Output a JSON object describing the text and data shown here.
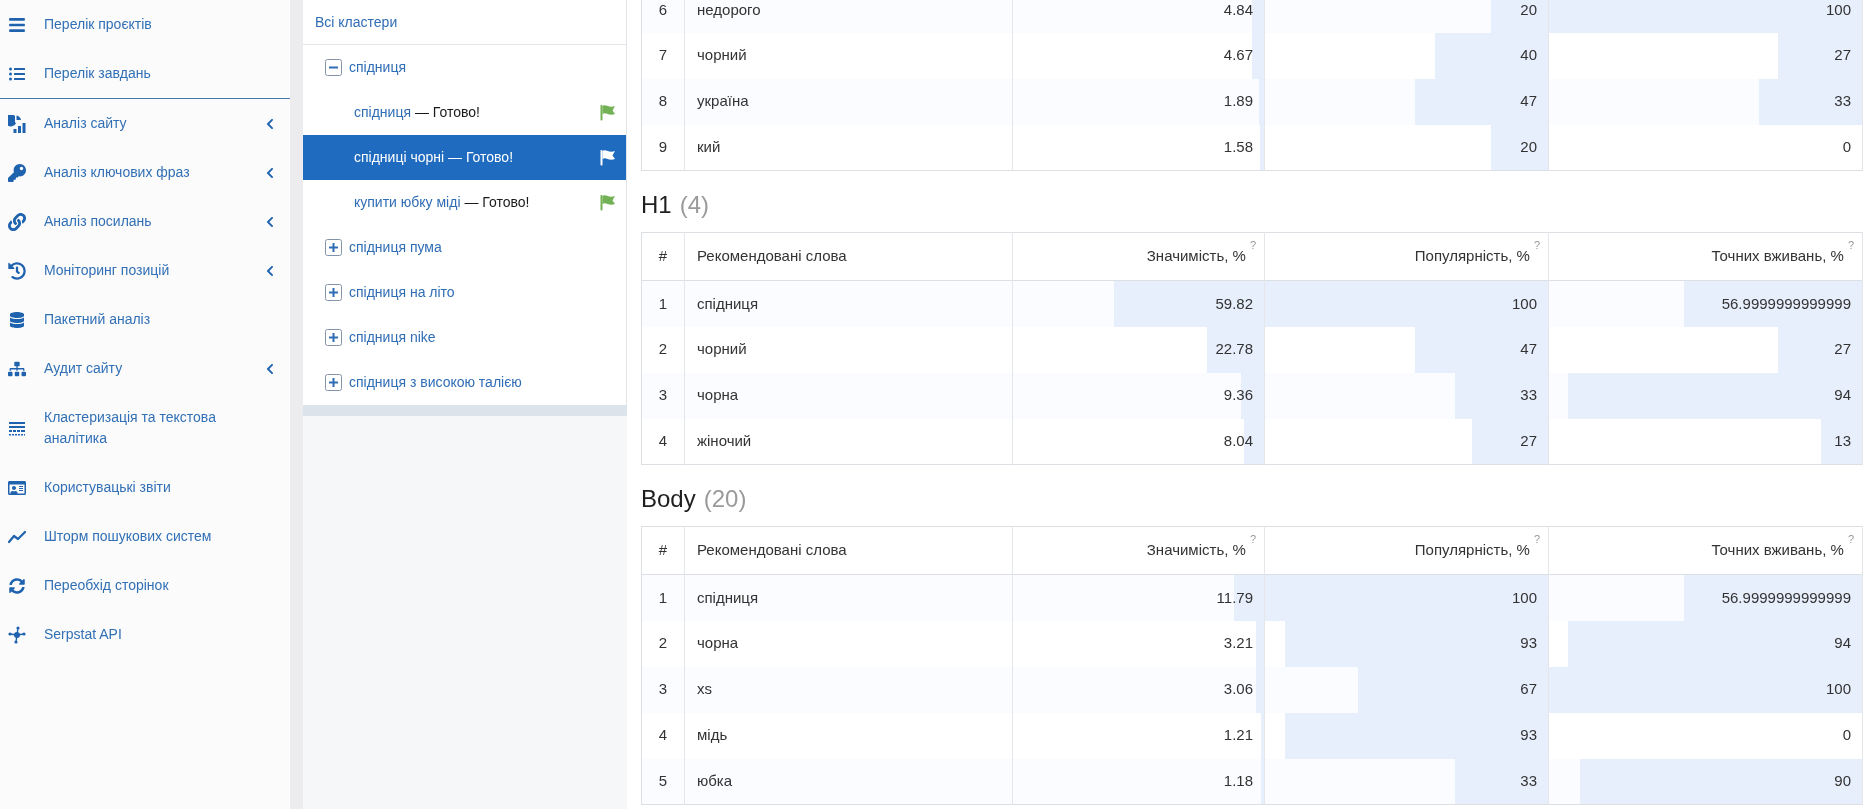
{
  "sidebar": {
    "top_items": [
      {
        "label": "Перелік проєктів",
        "has_submenu": false
      },
      {
        "label": "Перелік завдань",
        "has_submenu": false
      }
    ],
    "items": [
      {
        "label": "Аналіз сайту",
        "has_submenu": true
      },
      {
        "label": "Аналіз ключових фраз",
        "has_submenu": true
      },
      {
        "label": "Аналіз посилань",
        "has_submenu": true
      },
      {
        "label": "Моніторинг позицій",
        "has_submenu": true
      },
      {
        "label": "Пакетний аналіз",
        "has_submenu": false
      },
      {
        "label": "Аудит сайту",
        "has_submenu": true
      },
      {
        "label": "Кластеризація та текстова аналітика",
        "has_submenu": false
      },
      {
        "label": "Користувацькі звіти",
        "has_submenu": false
      },
      {
        "label": "Шторм пошукових систем",
        "has_submenu": false
      },
      {
        "label": "Переобхід сторінок",
        "has_submenu": false
      },
      {
        "label": "Serpstat API",
        "has_submenu": false
      }
    ]
  },
  "tree": {
    "header": "Всі кластери",
    "nodes": [
      {
        "label": "спідниця",
        "expanded": true,
        "children": [
          {
            "label": "спідниця",
            "status": "— Готово!",
            "selected": false
          },
          {
            "label": "спідниці чорні",
            "status": "— Готово!",
            "selected": true
          },
          {
            "label": "купити юбку міді",
            "status": "— Готово!",
            "selected": false
          }
        ]
      },
      {
        "label": "спідниця пума",
        "expanded": false
      },
      {
        "label": "спідниця на літо",
        "expanded": false
      },
      {
        "label": "спідниця nike",
        "expanded": false
      },
      {
        "label": "спідниця з високою талією",
        "expanded": false
      }
    ]
  },
  "sections": [
    {
      "rows": [
        {
          "number": "6",
          "word": "недорого",
          "metrics": [
            {
              "value": "4.84",
              "level": 0.0484
            },
            {
              "value": "20",
              "level": 0.2
            },
            {
              "value": "100",
              "level": 1
            }
          ]
        },
        {
          "number": "7",
          "word": "чорний",
          "metrics": [
            {
              "value": "4.67",
              "level": 0.0467
            },
            {
              "value": "40",
              "level": 0.4
            },
            {
              "value": "27",
              "level": 0.27
            }
          ]
        },
        {
          "number": "8",
          "word": "україна",
          "metrics": [
            {
              "value": "1.89",
              "level": 0.0189
            },
            {
              "value": "47",
              "level": 0.47
            },
            {
              "value": "33",
              "level": 0.33
            }
          ]
        },
        {
          "number": "9",
          "word": "кий",
          "metrics": [
            {
              "value": "1.58",
              "level": 0.0158
            },
            {
              "value": "20",
              "level": 0.2
            },
            {
              "value": "0",
              "level": 0
            }
          ]
        }
      ]
    },
    {
      "title": "H1",
      "count": "(4)",
      "columns": [
        {
          "label": "#"
        },
        {
          "label": "Рекомендовані слова"
        },
        {
          "label": "Значимість, %",
          "hint": "?"
        },
        {
          "label": "Популярність, %",
          "hint": "?"
        },
        {
          "label": "Точних вживань, %",
          "hint": "?"
        }
      ],
      "rows": [
        {
          "number": "1",
          "word": "спідниця",
          "metrics": [
            {
              "value": "59.82",
              "level": 0.5982
            },
            {
              "value": "100",
              "level": 1
            },
            {
              "value": "56.9999999999999",
              "level": 0.57
            }
          ]
        },
        {
          "number": "2",
          "word": "чорний",
          "metrics": [
            {
              "value": "22.78",
              "level": 0.2278
            },
            {
              "value": "47",
              "level": 0.47
            },
            {
              "value": "27",
              "level": 0.27
            }
          ]
        },
        {
          "number": "3",
          "word": "чорна",
          "metrics": [
            {
              "value": "9.36",
              "level": 0.0936
            },
            {
              "value": "33",
              "level": 0.33
            },
            {
              "value": "94",
              "level": 0.94
            }
          ]
        },
        {
          "number": "4",
          "word": "жіночий",
          "metrics": [
            {
              "value": "8.04",
              "level": 0.0804
            },
            {
              "value": "27",
              "level": 0.27
            },
            {
              "value": "13",
              "level": 0.13
            }
          ]
        }
      ]
    },
    {
      "title": "Body",
      "count": "(20)",
      "columns": [
        {
          "label": "#"
        },
        {
          "label": "Рекомендовані слова"
        },
        {
          "label": "Значимість, %",
          "hint": "?"
        },
        {
          "label": "Популярність, %",
          "hint": "?"
        },
        {
          "label": "Точних вживань, %",
          "hint": "?"
        }
      ],
      "rows": [
        {
          "number": "1",
          "word": "спідниця",
          "metrics": [
            {
              "value": "11.79",
              "level": 0.1179
            },
            {
              "value": "100",
              "level": 1
            },
            {
              "value": "56.9999999999999",
              "level": 0.57
            }
          ]
        },
        {
          "number": "2",
          "word": "чорна",
          "metrics": [
            {
              "value": "3.21",
              "level": 0.0321
            },
            {
              "value": "93",
              "level": 0.93
            },
            {
              "value": "94",
              "level": 0.94
            }
          ]
        },
        {
          "number": "3",
          "word": "xs",
          "metrics": [
            {
              "value": "3.06",
              "level": 0.0306
            },
            {
              "value": "67",
              "level": 0.67
            },
            {
              "value": "100",
              "level": 1
            }
          ]
        },
        {
          "number": "4",
          "word": "мідь",
          "metrics": [
            {
              "value": "1.21",
              "level": 0.0121
            },
            {
              "value": "93",
              "level": 0.93
            },
            {
              "value": "0",
              "level": 0
            }
          ]
        },
        {
          "number": "5",
          "word": "юбка",
          "metrics": [
            {
              "value": "1.18",
              "level": 0.0118
            },
            {
              "value": "33",
              "level": 0.33
            },
            {
              "value": "90",
              "level": 0.9
            }
          ]
        }
      ]
    }
  ]
}
